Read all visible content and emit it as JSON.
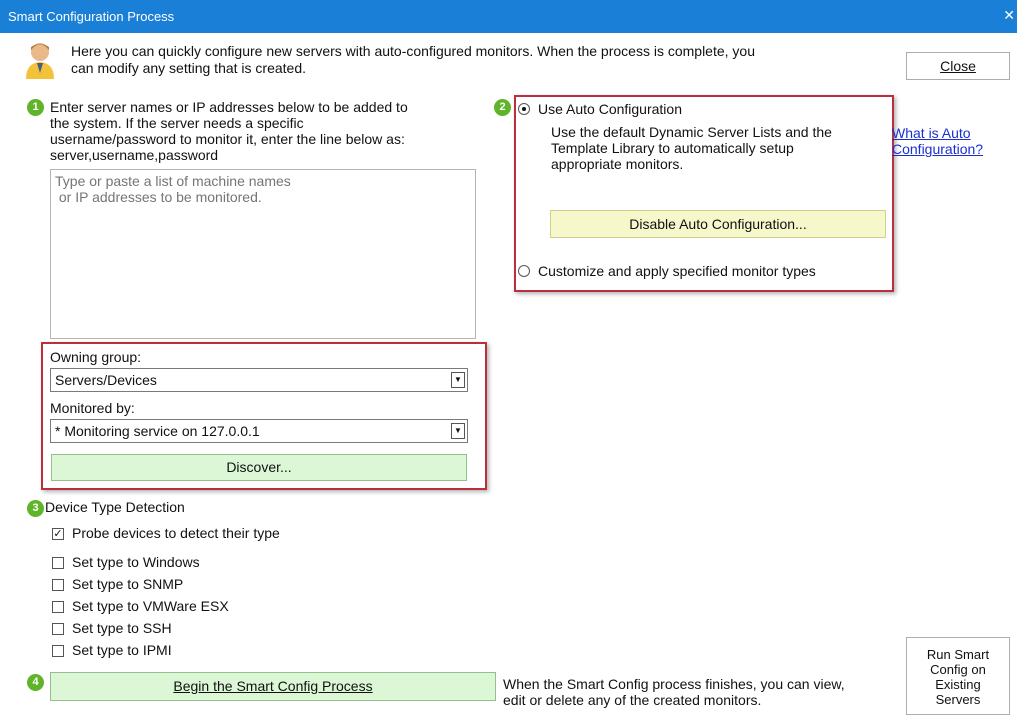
{
  "window": {
    "title": "Smart Configuration Process",
    "close_glyph": "✕"
  },
  "intro": {
    "line1": "Here you can quickly configure new servers with auto-configured monitors. When the process is complete, you",
    "line2": "can modify any setting that is created.",
    "avatar_icon": "user-avatar-icon"
  },
  "buttons": {
    "close": "Close",
    "discover": "Discover...",
    "disable_auto": "Disable Auto Configuration...",
    "begin": "Begin the Smart Config Process",
    "run_existing": [
      "Run Smart",
      "Config on",
      "Existing",
      "Servers"
    ]
  },
  "step1": {
    "number": "1",
    "instructions": [
      "Enter server names or IP addresses below to be added to",
      "the system.  If the server needs a specific",
      "username/password to monitor it, enter the line below as:",
      "server,username,password"
    ],
    "textarea_placeholder": "Type or paste a list of machine names\n or IP addresses to be monitored.",
    "owning_group_label": "Owning group:",
    "owning_group_value": "Servers/Devices",
    "monitored_by_label": "Monitored by:",
    "monitored_by_value": "* Monitoring service on 127.0.0.1"
  },
  "step2": {
    "number": "2",
    "option_auto": "Use Auto Configuration",
    "auto_selected": true,
    "auto_desc": [
      "Use the default Dynamic Server Lists and the",
      "Template Library to automatically setup",
      "appropriate monitors."
    ],
    "option_custom": "Customize and apply specified monitor types",
    "help_link": [
      "What is Auto",
      "Configuration?"
    ]
  },
  "step3": {
    "number": "3",
    "title": "Device Type Detection",
    "options": [
      {
        "label": "Probe devices to detect their type",
        "checked": true
      },
      {
        "label": "Set type to Windows",
        "checked": false
      },
      {
        "label": "Set type to SNMP",
        "checked": false
      },
      {
        "label": "Set type to VMWare ESX",
        "checked": false
      },
      {
        "label": "Set type to SSH",
        "checked": false
      },
      {
        "label": "Set type to IPMI",
        "checked": false
      }
    ]
  },
  "step4": {
    "number": "4",
    "note": [
      "When the Smart Config process finishes, you can view,",
      "edit or delete any of the created monitors."
    ]
  },
  "colors": {
    "titlebar": "#1a7fd6",
    "step_badge": "#5fb42a",
    "highlight_box": "#b9303a",
    "link": "#1a2fd0"
  }
}
